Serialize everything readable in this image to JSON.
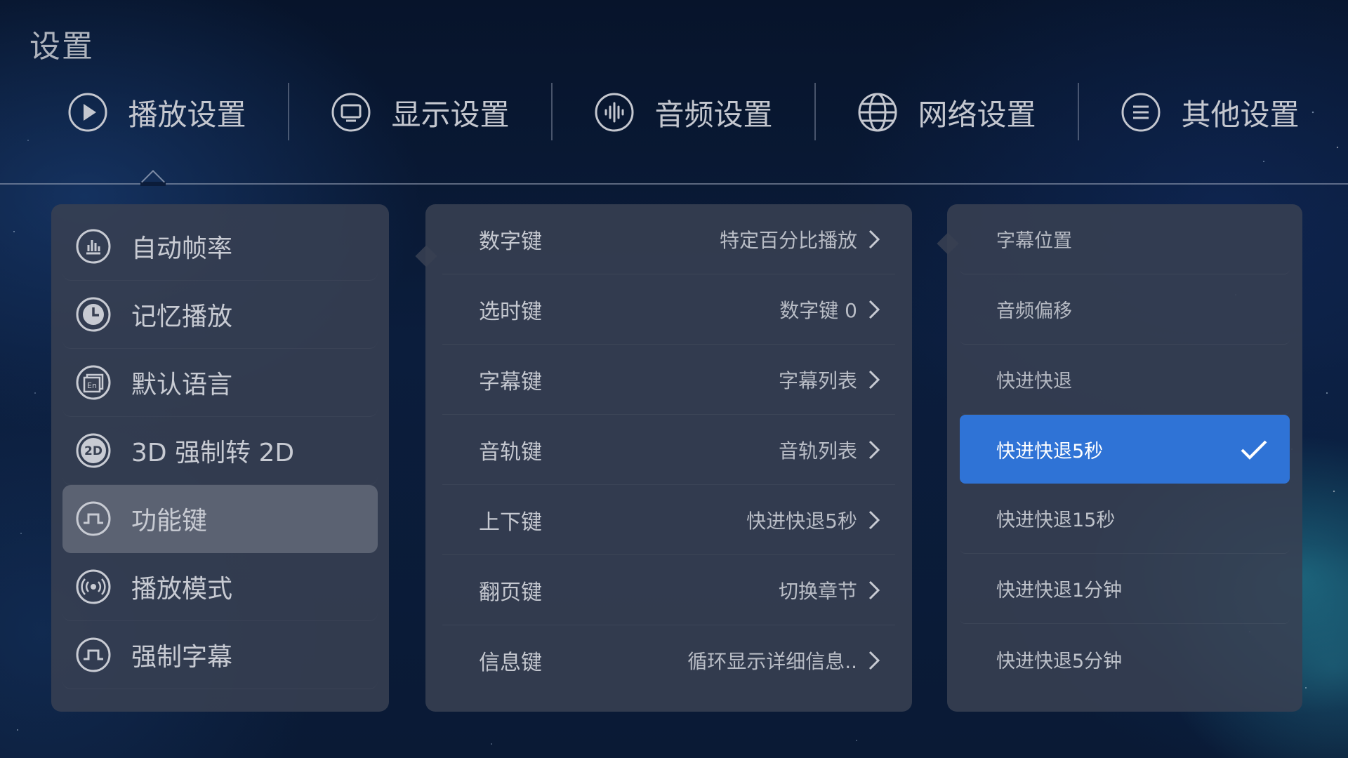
{
  "page": {
    "title": "设置"
  },
  "tabs": [
    {
      "label": "播放设置",
      "icon": "play-icon"
    },
    {
      "label": "显示设置",
      "icon": "monitor-icon"
    },
    {
      "label": "音频设置",
      "icon": "audio-wave-icon"
    },
    {
      "label": "网络设置",
      "icon": "globe-icon"
    },
    {
      "label": "其他设置",
      "icon": "menu-icon"
    }
  ],
  "active_tab": "播放设置",
  "left_menu": [
    {
      "label": "自动帧率",
      "icon": "bar-chart-icon"
    },
    {
      "label": "记忆播放",
      "icon": "clock-icon"
    },
    {
      "label": "默认语言",
      "icon": "language-icon"
    },
    {
      "label": "3D 强制转 2D",
      "icon": "2d-icon"
    },
    {
      "label": "功能键",
      "icon": "pulse-icon"
    },
    {
      "label": "播放模式",
      "icon": "broadcast-icon"
    },
    {
      "label": "强制字幕",
      "icon": "pulse-icon"
    }
  ],
  "left_selected": "功能键",
  "function_keys": [
    {
      "key": "数字键",
      "value": "特定百分比播放"
    },
    {
      "key": "选时键",
      "value": "数字键 0"
    },
    {
      "key": "字幕键",
      "value": "字幕列表"
    },
    {
      "key": "音轨键",
      "value": "音轨列表"
    },
    {
      "key": "上下键",
      "value": "快进快退5秒"
    },
    {
      "key": "翻页键",
      "value": "切换章节"
    },
    {
      "key": "信息键",
      "value": "循环显示详细信息.."
    }
  ],
  "options": [
    {
      "label": "字幕位置"
    },
    {
      "label": "音频偏移"
    },
    {
      "label": "快进快退"
    },
    {
      "label": "快进快退5秒",
      "selected": true
    },
    {
      "label": "快进快退15秒"
    },
    {
      "label": "快进快退1分钟"
    },
    {
      "label": "快进快退5分钟"
    }
  ],
  "colors": {
    "accent": "#2f73d6",
    "panel": "#384052",
    "selected_row": "#5b6272"
  }
}
